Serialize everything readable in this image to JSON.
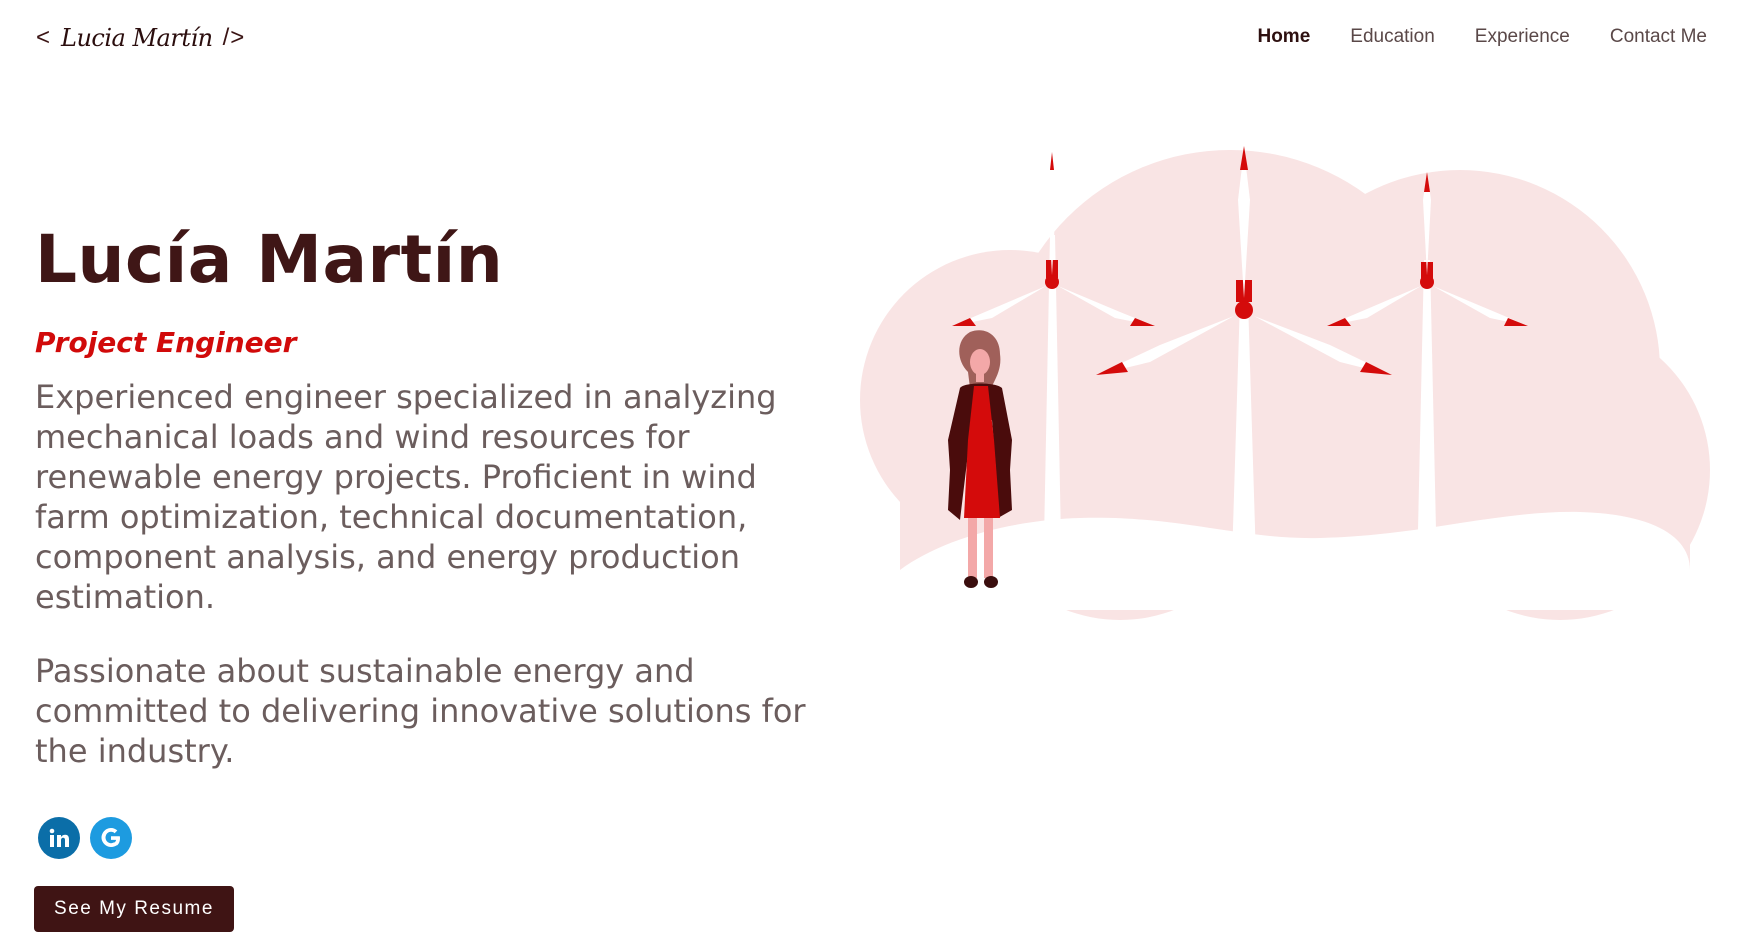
{
  "header": {
    "logo": {
      "open_bracket": "<",
      "signature": "Lucia Martín",
      "close_bracket": "/>"
    },
    "nav": [
      {
        "label": "Home",
        "active": true
      },
      {
        "label": "Education",
        "active": false
      },
      {
        "label": "Experience",
        "active": false
      },
      {
        "label": "Contact Me",
        "active": false
      }
    ]
  },
  "hero": {
    "name": "Lucía Martín",
    "role": "Project Engineer",
    "bio": "Experienced engineer specialized in analyzing mechanical loads and wind resources for renewable energy projects. Proficient in wind farm optimization, technical documentation, component analysis, and energy production estimation.",
    "bio2": "Passionate about sustainable energy and committed to delivering innovative solutions for the industry.",
    "resume_button": "See My Resume"
  },
  "social": [
    {
      "icon": "linkedin-icon",
      "glyph": "in",
      "color": "#0b6ea8"
    },
    {
      "icon": "google-icon",
      "glyph": "G",
      "color": "#1d9be0"
    }
  ],
  "colors": {
    "primary": "#3f1616",
    "accent": "#d10a0a",
    "text_muted": "#6b5d5d",
    "cloud": "#f9e4e4"
  }
}
